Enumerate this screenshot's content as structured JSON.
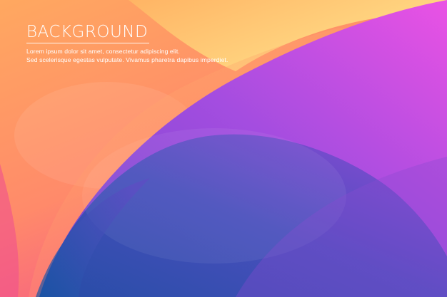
{
  "heading": {
    "title": "BACKGROUND"
  },
  "body": {
    "line1": "Lorem ipsum dolor sit amet, consectetur adipiscing elit.",
    "line2": "Sed scelerisque egestas vulputate. Vivamus pharetra dapibus imperdiet."
  },
  "colors": {
    "orange": "#ffa055",
    "yellow": "#ffd680",
    "pink": "#f7508c",
    "magenta": "#e24fe0",
    "purple": "#9b4bd8",
    "blue": "#1852a4",
    "text": "#ffffff"
  }
}
